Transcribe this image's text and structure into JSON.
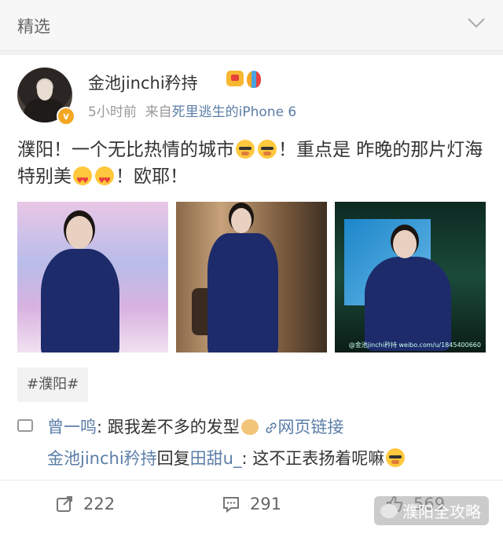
{
  "header": {
    "title": "精选"
  },
  "post": {
    "username": "金池jinchi矜持",
    "time": "5小时前",
    "source_prefix": "来自",
    "source": "死里逃生的iPhone 6",
    "text_1": "濮阳！一个无比热情的城市",
    "text_2": "！重点是 昨晚的那片灯海特别美",
    "text_3": "！欧耶！",
    "photo_watermark": "@金池jinchi矜持 weibo.com/u/1845400660",
    "hashtag": "#濮阳#"
  },
  "comments": [
    {
      "user": "曾一鸣",
      "sep": ": ",
      "text": "跟我差不多的发型",
      "link": "网页链接"
    },
    {
      "user": "金池jinchi矜持",
      "reply_word": "回复",
      "reply_to": "田甜u_",
      "text": ": 这不正表扬着呢嘛"
    }
  ],
  "actions": {
    "repost": "222",
    "comment": "291",
    "like": "569"
  },
  "overlay": {
    "wechat_label": "濮阳全攻略"
  },
  "colors": {
    "link": "#5b7ea8",
    "vip": "#f5a623"
  }
}
